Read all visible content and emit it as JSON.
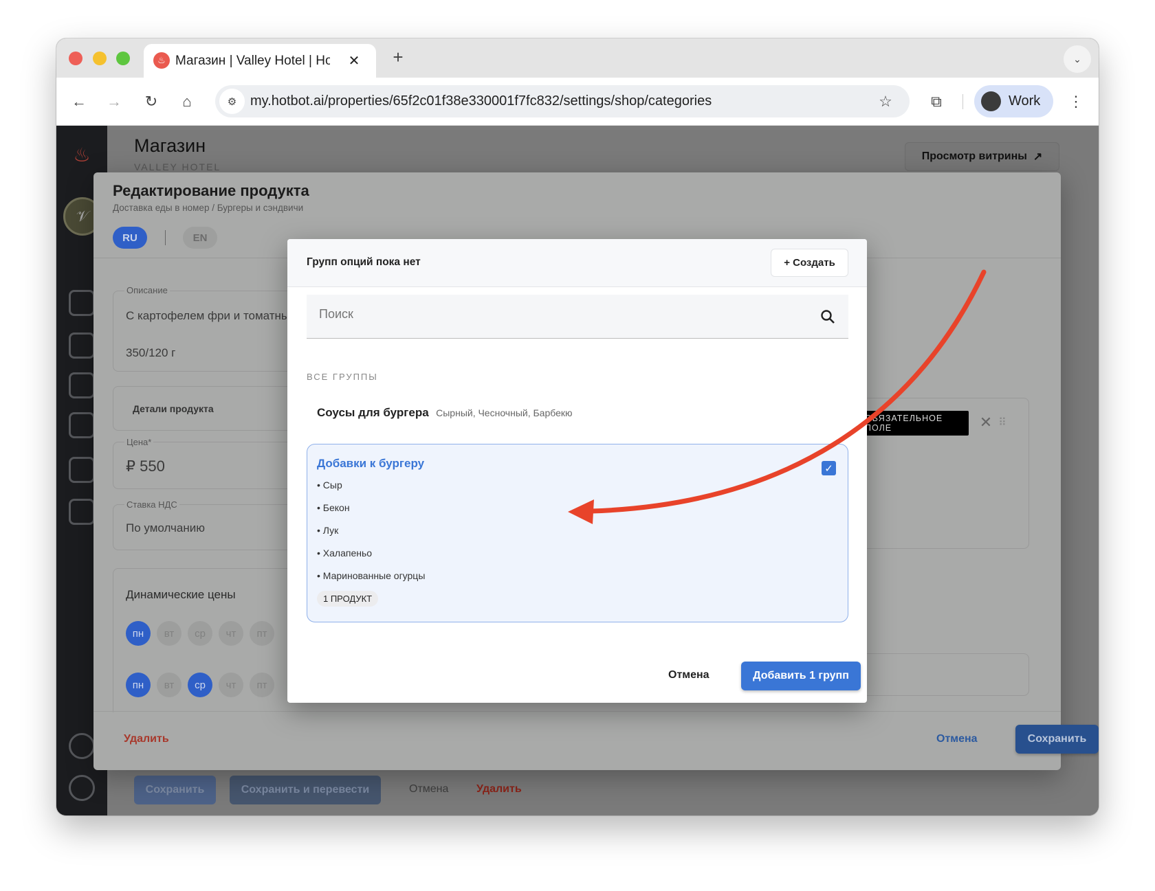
{
  "browser": {
    "tab_title": "Магазин | Valley Hotel | Hotbot",
    "url": "my.hotbot.ai/properties/65f2c01f38e330001f7fc832/settings/shop/categories",
    "profile": "Work"
  },
  "page": {
    "title": "Магазин",
    "subtitle": "VALLEY HOTEL",
    "storefront_button": "Просмотр витрины",
    "bottom_buttons": {
      "save": "Сохранить",
      "save_translate": "Сохранить и перевести",
      "cancel": "Отмена",
      "delete": "Удалить"
    }
  },
  "edit_panel": {
    "title": "Редактирование продукта",
    "breadcrumb": "Доставка еды в номер / Бургеры и сэндвичи",
    "lang_tabs": [
      "RU",
      "EN"
    ],
    "description_label": "Описание",
    "description_line1": "С картофелем фри и томатны",
    "description_line2": "350/120 г",
    "details_label": "Детали продукта",
    "price_label": "Цена*",
    "price_value": "₽ 550",
    "vat_label": "Ставка НДС",
    "vat_value": "По умолчанию",
    "dynamic_prices_title": "Динамические цены",
    "day_rows": [
      [
        {
          "d": "пн",
          "on": true
        },
        {
          "d": "вт",
          "on": false
        },
        {
          "d": "ср",
          "on": false
        },
        {
          "d": "чт",
          "on": false
        },
        {
          "d": "пт",
          "on": false
        }
      ],
      [
        {
          "d": "пн",
          "on": true
        },
        {
          "d": "вт",
          "on": false
        },
        {
          "d": "ср",
          "on": true
        },
        {
          "d": "чт",
          "on": false
        },
        {
          "d": "пт",
          "on": false
        }
      ]
    ],
    "required_badge": "ОБЯЗАТЕЛЬНОЕ ПОЛЕ",
    "delete": "Удалить",
    "cancel": "Отмена",
    "save": "Сохранить"
  },
  "dialog": {
    "title": "Групп опций пока нет",
    "create_button": "+ Создать",
    "search_placeholder": "Поиск",
    "section_label": "ВСЕ ГРУППЫ",
    "groups": [
      {
        "name": "Соусы для бургера",
        "summary": "Сырный, Чесночный, Барбекю",
        "selected": false
      },
      {
        "name": "Добавки к бургеру",
        "items": [
          "• Сыр",
          "• Бекон",
          "• Лук",
          "• Халапеньо",
          "• Маринованные огурцы"
        ],
        "badge": "1 ПРОДУКТ",
        "selected": true
      }
    ],
    "cancel": "Отмена",
    "add_button": "Добавить 1 групп"
  },
  "colors": {
    "accent": "#3a76d6",
    "danger": "#c0392b",
    "annotation_arrow": "#e8432a"
  }
}
